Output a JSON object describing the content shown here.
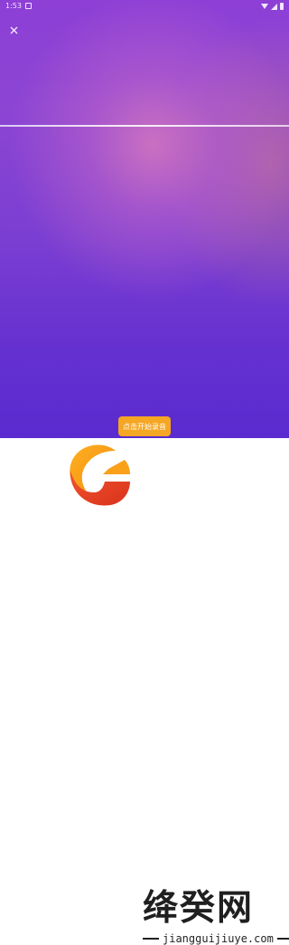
{
  "status_bar": {
    "time": "1:53",
    "icons": [
      "app-notification-icon",
      "wifi-icon",
      "signal-icon",
      "battery-icon"
    ]
  },
  "toolbar": {
    "close_icon": "close-icon"
  },
  "main": {
    "record_button_label": "点击开始录音"
  },
  "watermark": {
    "logo_icon": "g-swirl-logo-icon",
    "logo_text": "绛癸网",
    "domain": "jiangguijiuye.com"
  },
  "colors": {
    "accent": "#f5a623",
    "background_top": "#8d3fd6",
    "background_bottom": "#5a2bcf"
  }
}
